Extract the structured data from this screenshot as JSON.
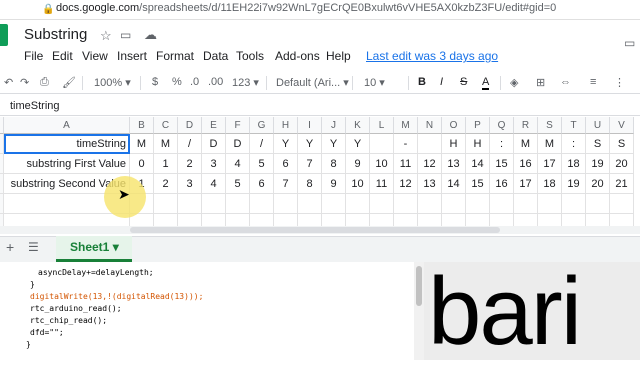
{
  "browser": {
    "url_host": "docs.google.com",
    "url_path": "/spreadsheets/d/11EH22i7w92WnL7gECrQE0Bxulwt6vVHE5AX0kzbZ3FU/edit#gid=0"
  },
  "doc": {
    "title": "Substring"
  },
  "menu": [
    "File",
    "Edit",
    "View",
    "Insert",
    "Format",
    "Data",
    "Tools",
    "Add-ons",
    "Help"
  ],
  "last_edit": "Last edit was 3 days ago",
  "toolbar": {
    "zoom": "100%",
    "currency": "$",
    "percent": "%",
    "dec_dec": ".0",
    "dec_inc": ".00",
    "more_formats": "123",
    "font": "Default (Ari...",
    "font_size": "10",
    "bold": "B",
    "italic": "I",
    "strike": "S",
    "text_color": "A"
  },
  "formula_bar": {
    "name_box": "timeString"
  },
  "columns": [
    "A",
    "B",
    "C",
    "D",
    "E",
    "F",
    "G",
    "H",
    "I",
    "J",
    "K",
    "L",
    "M",
    "N",
    "O",
    "P",
    "Q",
    "R",
    "S",
    "T",
    "U",
    "V"
  ],
  "rows": [
    {
      "label": "timeString",
      "cells": [
        "M",
        "M",
        "/",
        "D",
        "D",
        "/",
        "Y",
        "Y",
        "Y",
        "Y",
        "",
        "-",
        "",
        "H",
        "H",
        ":",
        "M",
        "M",
        ":",
        "S",
        "S"
      ]
    },
    {
      "label": "substring First Value",
      "cells": [
        "0",
        "1",
        "2",
        "3",
        "4",
        "5",
        "6",
        "7",
        "8",
        "9",
        "10",
        "11",
        "12",
        "13",
        "14",
        "15",
        "16",
        "17",
        "18",
        "19",
        "20"
      ]
    },
    {
      "label": "substring Second Value",
      "cells": [
        "1",
        "2",
        "3",
        "4",
        "5",
        "6",
        "7",
        "8",
        "9",
        "10",
        "11",
        "12",
        "13",
        "14",
        "15",
        "16",
        "17",
        "18",
        "19",
        "20",
        "21"
      ]
    }
  ],
  "sheet_tab": "Sheet1",
  "code_lines": [
    "asyncDelay+=delayLength;",
    "}",
    "digitalWrite(13,!(digitalRead(13)));",
    "rtc_arduino_read();",
    "rtc_chip_read();",
    "dfd=\"\";",
    "}"
  ],
  "video_text": "bari"
}
